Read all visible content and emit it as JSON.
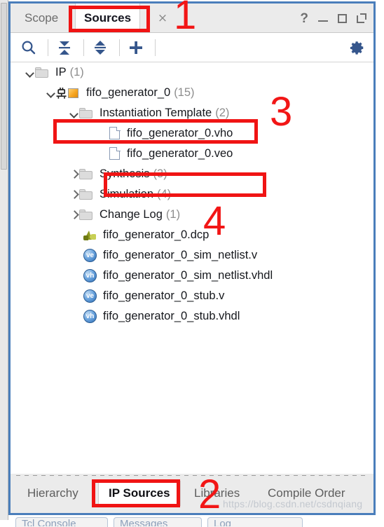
{
  "window": {
    "tabs": [
      {
        "label": "Scope",
        "selected": false
      },
      {
        "label": "Sources",
        "selected": true
      }
    ],
    "close_label": "×",
    "controls": [
      {
        "name": "help",
        "glyph": "?"
      },
      {
        "name": "minimize",
        "glyph": ""
      },
      {
        "name": "maximize",
        "glyph": ""
      },
      {
        "name": "float",
        "glyph": ""
      }
    ]
  },
  "toolbar": {
    "search_label": "Search",
    "collapse_all_label": "Collapse All",
    "expand_all_label": "Expand All",
    "add_sources_label": "Add Sources",
    "settings_label": "Settings"
  },
  "tree": {
    "rows": [
      {
        "id": "ip",
        "indent": "i0",
        "arrow": "down",
        "icon": "folder",
        "label": "IP",
        "count": "(1)"
      },
      {
        "id": "fifo_gen_0",
        "indent": "i1",
        "arrow": "down",
        "icon": "ip",
        "label": "fifo_generator_0",
        "count": "(15)"
      },
      {
        "id": "inst_template",
        "indent": "i2",
        "arrow": "down",
        "icon": "folder",
        "label": "Instantiation Template",
        "count": "(2)"
      },
      {
        "id": "vho",
        "indent": "i3",
        "arrow": "none",
        "icon": "doc",
        "label": "fifo_generator_0.vho",
        "count": ""
      },
      {
        "id": "veo",
        "indent": "i3",
        "arrow": "none",
        "icon": "doc",
        "label": "fifo_generator_0.veo",
        "count": ""
      },
      {
        "id": "synthesis",
        "indent": "i2",
        "arrow": "right",
        "icon": "folder",
        "label": "Synthesis",
        "count": "(3)"
      },
      {
        "id": "simulation",
        "indent": "i2",
        "arrow": "right",
        "icon": "folder",
        "label": "Simulation",
        "count": "(4)"
      },
      {
        "id": "change_log",
        "indent": "i2",
        "arrow": "right",
        "icon": "folder",
        "label": "Change Log",
        "count": "(1)"
      },
      {
        "id": "dcp",
        "indent": "i4",
        "arrow": "none",
        "icon": "dcp",
        "label": "fifo_generator_0.dcp",
        "count": ""
      },
      {
        "id": "sim_netlist_v",
        "indent": "i4",
        "arrow": "none",
        "icon": "badge-ve",
        "label": "fifo_generator_0_sim_netlist.v",
        "count": ""
      },
      {
        "id": "sim_netlist_vhdl",
        "indent": "i4",
        "arrow": "none",
        "icon": "badge-vh",
        "label": "fifo_generator_0_sim_netlist.vhdl",
        "count": ""
      },
      {
        "id": "stub_v",
        "indent": "i4",
        "arrow": "none",
        "icon": "badge-ve",
        "label": "fifo_generator_0_stub.v",
        "count": ""
      },
      {
        "id": "stub_vhdl",
        "indent": "i4",
        "arrow": "none",
        "icon": "badge-vh",
        "label": "fifo_generator_0_stub.vhdl",
        "count": ""
      }
    ],
    "badge_ve_text": "ve",
    "badge_vh_text": "vh"
  },
  "bottom_tabs": [
    {
      "label": "Hierarchy",
      "selected": false
    },
    {
      "label": "IP Sources",
      "selected": true
    },
    {
      "label": "Libraries",
      "selected": false
    },
    {
      "label": "Compile Order",
      "selected": false
    }
  ],
  "under_tabs": [
    {
      "label": "Tcl Console"
    },
    {
      "label": "Messages"
    },
    {
      "label": "Log"
    }
  ],
  "annotations": {
    "numbers": [
      {
        "id": "step-1",
        "text": "1"
      },
      {
        "id": "step-2",
        "text": "2"
      },
      {
        "id": "step-3",
        "text": "3"
      },
      {
        "id": "step-4",
        "text": "4"
      }
    ],
    "highlight_color": "#f01414"
  },
  "watermark": {
    "text": "https://blog.csdn.net/csdnqiang"
  }
}
